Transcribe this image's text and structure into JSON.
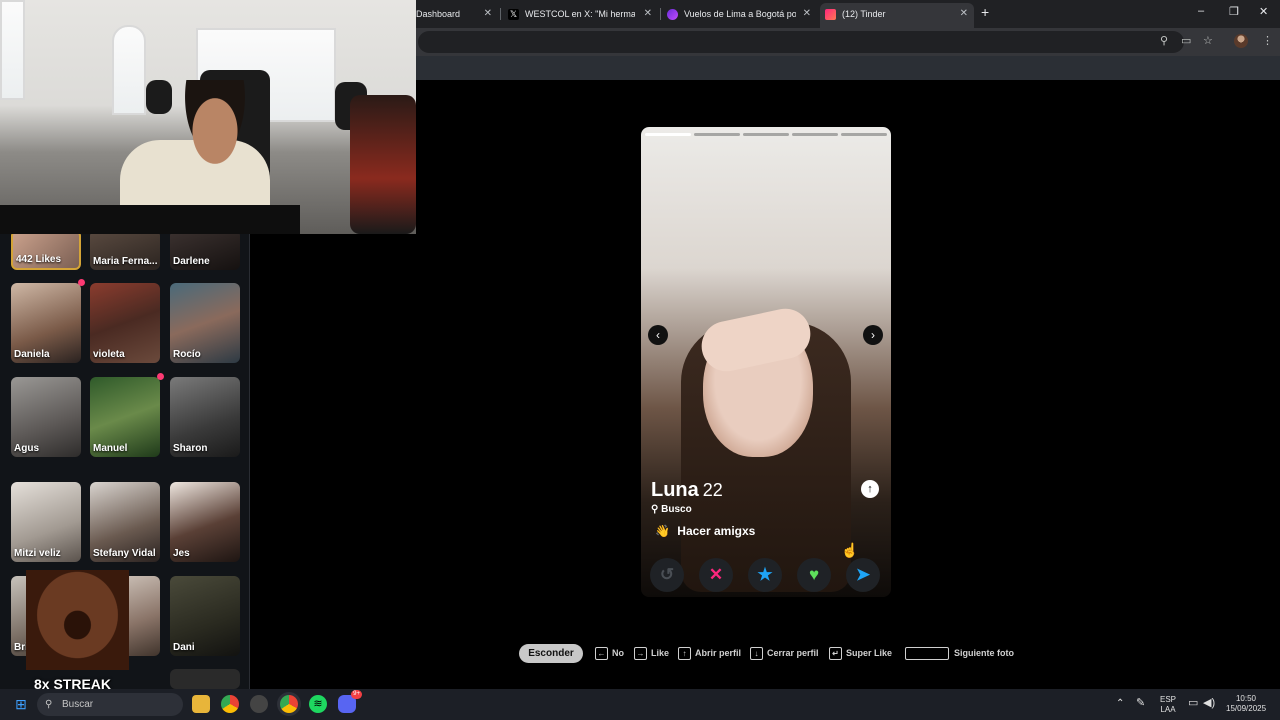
{
  "browser": {
    "tabs": [
      {
        "title": "Dashboard",
        "active": false
      },
      {
        "title": "WESTCOL en X: \"Mi hermanito \"",
        "active": false
      },
      {
        "title": "Vuelos de Lima a Bogotá por S/",
        "active": false
      },
      {
        "title": "(12) Tinder",
        "active": true
      }
    ],
    "new_tab": "+",
    "window_controls": {
      "minimize": "–",
      "restore": "❐",
      "close": "✕"
    }
  },
  "sidebar": {
    "likes_tile": {
      "label": "442 Likes"
    },
    "profiles": [
      {
        "name": "Maria Ferna...",
        "unread": false
      },
      {
        "name": "Darlene",
        "unread": false
      },
      {
        "name": "Daniela",
        "unread": true
      },
      {
        "name": "violeta",
        "unread": false
      },
      {
        "name": "Rocío",
        "unread": false
      },
      {
        "name": "Agus",
        "unread": false
      },
      {
        "name": "Manuel",
        "unread": true
      },
      {
        "name": "Sharon",
        "unread": false
      },
      {
        "name": "Mitzi veliz",
        "unread": false
      },
      {
        "name": "Stefany Vidal",
        "unread": false
      },
      {
        "name": "Jes",
        "unread": false
      },
      {
        "name": "Bri",
        "unread": false
      },
      {
        "name": "Dani",
        "unread": false
      }
    ]
  },
  "overlay": {
    "streak": "8x STREAK"
  },
  "card": {
    "name": "Luna",
    "age": "22",
    "busco_label": "Busco",
    "busco_emoji": "👋",
    "busco_value": "Hacer amigxs",
    "photo_count": 5,
    "current_photo": 1,
    "prev_arrow": "‹",
    "next_arrow": "›",
    "info_icon": "↑",
    "actions": [
      {
        "name": "rewind",
        "glyph": "↺",
        "color": "#4a4f55"
      },
      {
        "name": "nope",
        "glyph": "✕",
        "color": "#fd267d"
      },
      {
        "name": "super-like",
        "glyph": "★",
        "color": "#1ea4f5"
      },
      {
        "name": "like",
        "glyph": "♥",
        "color": "#5ee05b"
      },
      {
        "name": "boost",
        "glyph": "➤",
        "color": "#1ea4f5"
      }
    ]
  },
  "shortcuts": {
    "hide": "Esconder",
    "items": [
      {
        "key": "←",
        "label": "No"
      },
      {
        "key": "→",
        "label": "Like"
      },
      {
        "key": "↑",
        "label": "Abrir perfil"
      },
      {
        "key": "↓",
        "label": "Cerrar perfil"
      },
      {
        "key": "↵",
        "label": "Super Like"
      },
      {
        "key": "",
        "label": "Siguiente foto"
      }
    ]
  },
  "taskbar": {
    "search_placeholder": "Buscar",
    "language": "ESP",
    "layout": "LAA",
    "time": "10:50",
    "date": "15/09/2025",
    "discord_badge": "9+"
  }
}
